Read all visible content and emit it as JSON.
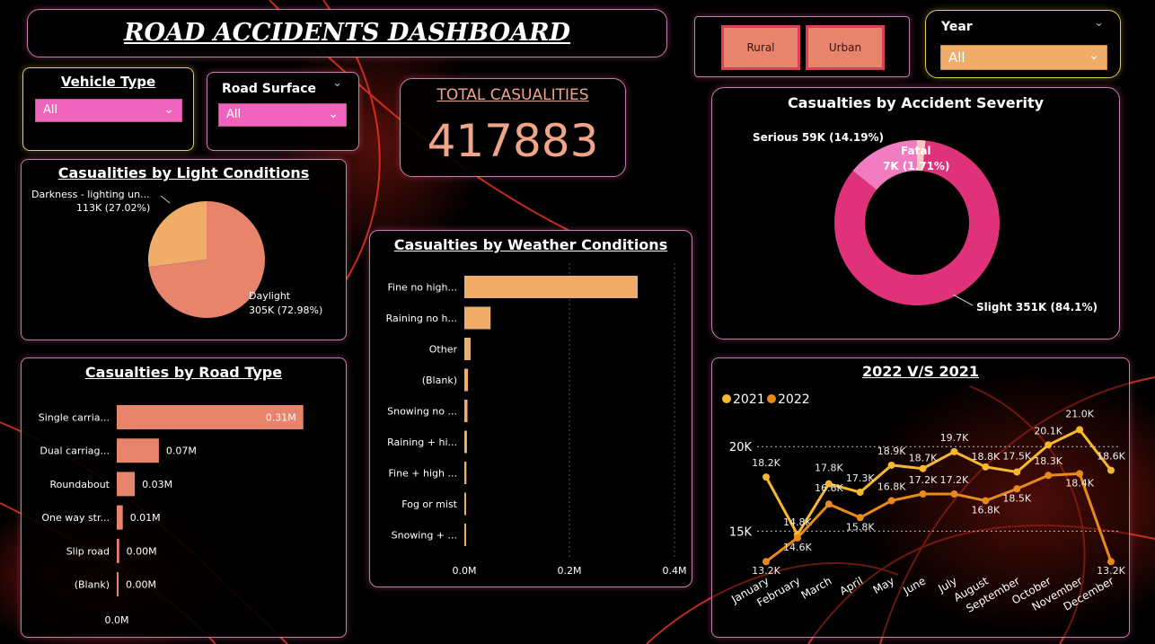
{
  "dashboard": {
    "title": "ROAD ACCIDENTS DASHBOARD"
  },
  "filters": {
    "vehicle_type": {
      "label": "Vehicle Type",
      "value": "All"
    },
    "road_surface": {
      "label": "Road Surface",
      "value": "All"
    },
    "year": {
      "label": "Year",
      "value": "All"
    },
    "area_buttons": [
      "Rural",
      "Urban"
    ]
  },
  "kpi": {
    "label": "TOTAL CASUALITIES",
    "value": "417883"
  },
  "colors": {
    "salmon": "#e8836c",
    "light_orange": "#f0ad6a",
    "pink": "#f064be",
    "deep_pink": "#e0327a",
    "light_pink": "#f27cc0",
    "gold": "#f5b82e",
    "orange": "#e88a1a"
  },
  "chart_data": [
    {
      "type": "pie",
      "title": "Casualities by Light Conditions",
      "slices": [
        {
          "label": "Darkness - lighting un...",
          "value_label": "113K (27.02%)",
          "value": 113,
          "percent": 27.02,
          "color": "#f0ad6a"
        },
        {
          "label": "Daylight",
          "value_label": "305K (72.98%)",
          "value": 305,
          "percent": 72.98,
          "color": "#e8836c"
        }
      ]
    },
    {
      "type": "bar",
      "orientation": "horizontal",
      "title": "Casualties by Road Type",
      "categories": [
        "Single carria...",
        "Dual carriag...",
        "Roundabout",
        "One way str...",
        "Slip road",
        "(Blank)"
      ],
      "values": [
        0.31,
        0.07,
        0.03,
        0.01,
        0.004,
        0.001
      ],
      "data_labels": [
        "0.31M",
        "0.07M",
        "0.03M",
        "0.01M",
        "0.00M",
        "0.00M"
      ],
      "xlim": [
        0,
        0.4
      ],
      "ticks": [
        "0.0M",
        "0.2M"
      ],
      "color": "#e8836c"
    },
    {
      "type": "bar",
      "orientation": "horizontal",
      "title": "Casualties by Weather Conditions",
      "categories": [
        "Fine no high...",
        "Raining no h...",
        "Other",
        "(Blank)",
        "Snowing no ...",
        "Raining + hi...",
        "Fine + high ...",
        "Fog or mist",
        "Snowing + ..."
      ],
      "values": [
        0.33,
        0.05,
        0.012,
        0.007,
        0.006,
        0.005,
        0.004,
        0.002,
        0.001
      ],
      "xlim": [
        0,
        0.4
      ],
      "ticks": [
        "0.0M",
        "0.2M",
        "0.4M"
      ],
      "color": "#f0ad6a"
    },
    {
      "type": "pie",
      "subtype": "donut",
      "title": "Casualties by Accident Severity",
      "slices": [
        {
          "label": "Slight",
          "value_label": "351K (84.1%)",
          "value": 351,
          "percent": 84.1,
          "color": "#e0327a"
        },
        {
          "label": "Serious",
          "value_label": "59K (14.19%)",
          "value": 59,
          "percent": 14.19,
          "color": "#f27cc0"
        },
        {
          "label": "Fatal",
          "value_label": "7K (1.71%)",
          "value": 7,
          "percent": 1.71,
          "color": "#f7c9c0"
        }
      ],
      "text_labels": {
        "slight": "Slight 351K (84.1%)",
        "serious": "Serious 59K (14.19%)",
        "fatal_1": "Fatal",
        "fatal_2": "7K (1.71%)"
      }
    },
    {
      "type": "line",
      "title": "2022 V/S 2021",
      "x": [
        "January",
        "February",
        "March",
        "April",
        "May",
        "June",
        "July",
        "August",
        "September",
        "October",
        "November",
        "December"
      ],
      "ylim": [
        13,
        21.5
      ],
      "y_ticks": [
        "20K",
        "15K"
      ],
      "y_tick_values": [
        20,
        15
      ],
      "series": [
        {
          "name": "2021",
          "color": "#f5b82e",
          "values": [
            18.2,
            14.8,
            17.8,
            17.3,
            18.9,
            18.7,
            19.7,
            18.8,
            18.5,
            20.1,
            21.0,
            18.6
          ],
          "labels": [
            "18.2K",
            "14.8K",
            "17.8K",
            "17.3K",
            "18.9K",
            "18.7K",
            "19.7K",
            "18.8K",
            "17.5K",
            "20.1K",
            "21.0K",
            "18.6K"
          ]
        },
        {
          "name": "2022",
          "color": "#e88a1a",
          "values": [
            13.2,
            14.6,
            16.6,
            15.8,
            16.8,
            17.2,
            17.2,
            16.8,
            17.5,
            18.3,
            18.4,
            13.2
          ],
          "labels": [
            "13.2K",
            "14.6K",
            "16.6K",
            "15.8K",
            "16.8K",
            "17.2K",
            "17.2K",
            "16.8K",
            "18.5K",
            "18.3K",
            "18.4K",
            "13.2K"
          ]
        }
      ]
    }
  ]
}
